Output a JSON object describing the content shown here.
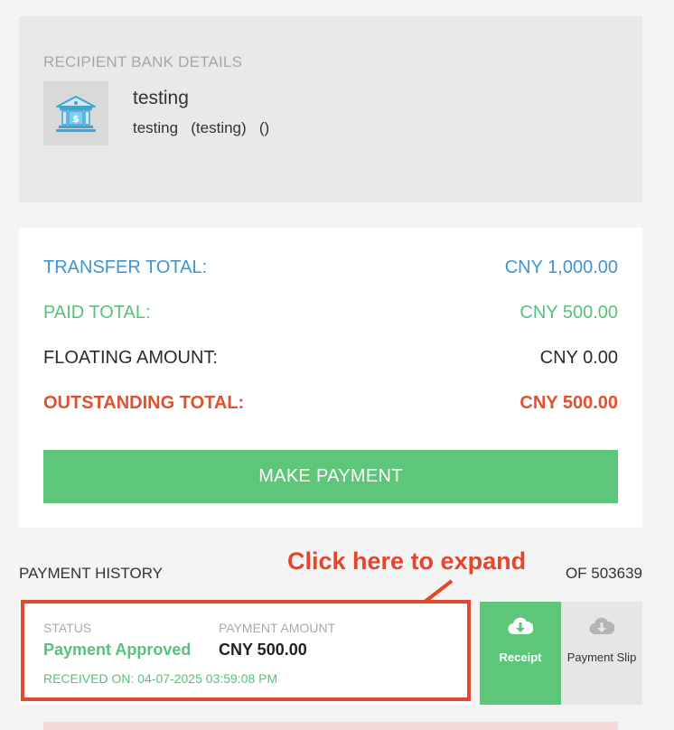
{
  "recipient": {
    "section_label": "RECIPIENT BANK DETAILS",
    "bank_name": "testing",
    "bank_details": "testing   (testing)   ()",
    "icon": "bank-icon"
  },
  "totals": {
    "transfer_label": "TRANSFER TOTAL:",
    "transfer_value": "CNY 1,000.00",
    "paid_label": "PAID TOTAL:",
    "paid_value": "CNY 500.00",
    "floating_label": "FLOATING AMOUNT:",
    "floating_value": "CNY 0.00",
    "outstanding_label": "OUTSTANDING TOTAL:",
    "outstanding_value": "CNY 500.00",
    "make_payment_label": "MAKE PAYMENT"
  },
  "history": {
    "title": "PAYMENT HISTORY",
    "reference": "OF 503639",
    "annotation": "Click here to expand",
    "items": [
      {
        "status_label": "STATUS",
        "status": "Payment Approved",
        "amount_label": "PAYMENT AMOUNT",
        "amount": "CNY 500.00",
        "received": "RECEIVED ON: 04-07-2025 03:59:08 PM",
        "receipt_label": "Receipt",
        "slip_label": "Payment Slip"
      }
    ]
  },
  "colors": {
    "blue": "#3d95d6",
    "green": "#5ec679",
    "red": "#e0512f",
    "annotation_red": "#e5452b"
  }
}
